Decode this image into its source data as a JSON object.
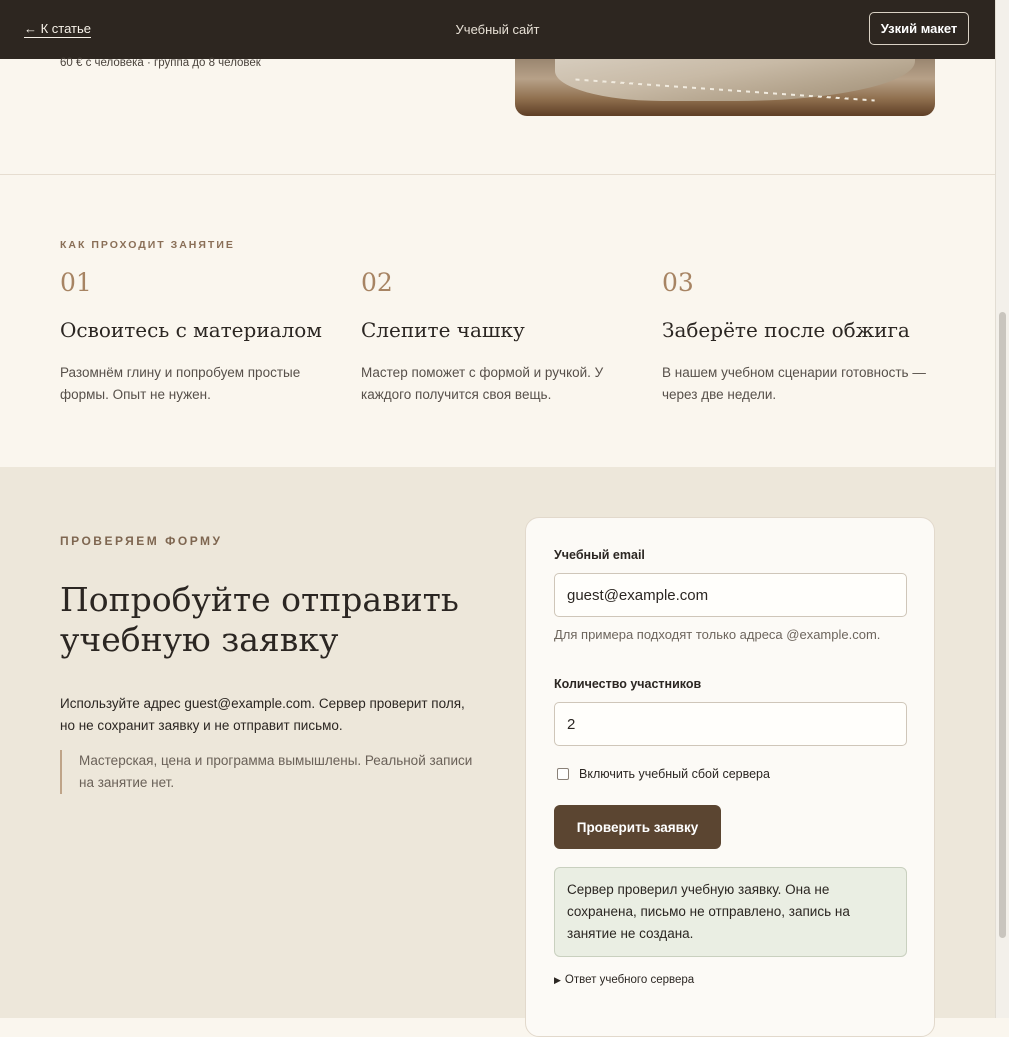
{
  "topbar": {
    "back_label": "← К статье",
    "site_title": "Учебный сайт",
    "narrow_button": "Узкий макет"
  },
  "hero": {
    "meta": "60 € с человека · группа до 8 человек"
  },
  "steps_section": {
    "eyebrow": "КАК ПРОХОДИТ ЗАНЯТИЕ",
    "steps": [
      {
        "num": "01",
        "title": "Освоитесь с материалом",
        "text": "Разомнём глину и попробуем простые формы. Опыт не нужен."
      },
      {
        "num": "02",
        "title": "Слепите чашку",
        "text": "Мастер поможет с формой и ручкой. У каждого получится своя вещь."
      },
      {
        "num": "03",
        "title": "Заберёте после обжига",
        "text": "В нашем учебном сценарии готовность — через две недели."
      }
    ]
  },
  "form_section": {
    "eyebrow": "ПРОВЕРЯЕМ ФОРМУ",
    "heading": "Попробуйте отправить учебную заявку",
    "lead": "Используйте адрес guest@example.com. Сервер проверит поля, но не сохранит заявку и не отправит письмо.",
    "note": "Мастерская, цена и программа вымышлены. Реальной записи на занятие нет.",
    "form": {
      "email_label": "Учебный email",
      "email_value": "guest@example.com",
      "email_hint": "Для примера подходят только адреса @example.com.",
      "count_label": "Количество участников",
      "count_value": "2",
      "checkbox_label": "Включить учебный сбой сервера",
      "checkbox_checked": false,
      "submit_label": "Проверить заявку",
      "result_text": "Сервер проверил учебную заявку. Она не сохранена, письмо не отправлено, запись на занятие не создана.",
      "details_label": "Ответ учебного сервера"
    }
  }
}
